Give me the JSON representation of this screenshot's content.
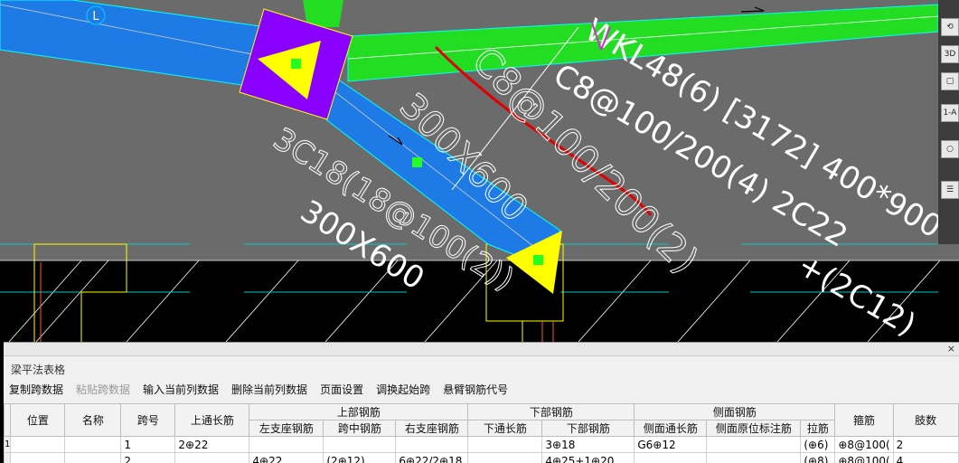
{
  "cad": {
    "axis_label": "L",
    "beam_text_1": "WKL48(6) [3172] 400*900",
    "beam_text_2": "C8@100/200(4) 2C22",
    "beam_text_3": "+(2C12)",
    "beam_text_4": "3C18(18@100(2))",
    "beam_text_5": "300X600",
    "handwritten_1": "C8@100/200(2)",
    "handwritten_2": "300X600",
    "handwritten_3": "3C18",
    "colors": {
      "background": "#6b6b6b",
      "blue_beam": "#1e7be6",
      "green_beam": "#22dd22",
      "column": "#8a00ff",
      "marker": "#ffff00",
      "red_annotation": "#e00000",
      "magenta_text": "#cc33cc"
    }
  },
  "right_tools": [
    "3D",
    "1-A"
  ],
  "panel": {
    "title": "梁平法表格",
    "close_icon": "×",
    "toolbar": [
      {
        "label": "复制跨数据",
        "enabled": true
      },
      {
        "label": "粘贴跨数据",
        "enabled": false
      },
      {
        "label": "输入当前列数据",
        "enabled": true
      },
      {
        "label": "删除当前列数据",
        "enabled": true
      },
      {
        "label": "页面设置",
        "enabled": true
      },
      {
        "label": "调换起始跨",
        "enabled": true
      },
      {
        "label": "悬臂钢筋代号",
        "enabled": true
      }
    ],
    "group_headers": {
      "top": "上部钢筋",
      "bottom": "下部钢筋",
      "side": "侧面钢筋"
    },
    "columns": {
      "position": "位置",
      "name": "名称",
      "span": "跨号",
      "top_through": "上通长筋",
      "left_support": "左支座钢筋",
      "mid_span": "跨中钢筋",
      "right_support": "右支座钢筋",
      "bottom_through": "下通长筋",
      "bottom_bar": "下部钢筋",
      "side_through": "侧面通长筋",
      "side_local": "侧面原位标注筋",
      "tie": "拉筋",
      "stirrup": "箍筋",
      "legs": "肢数"
    },
    "rows": [
      {
        "num": "1",
        "position": "",
        "name": "",
        "span": "1",
        "top_through": "2⊕22",
        "left_support": "",
        "mid_span": "",
        "right_support": "",
        "bottom_through": "",
        "bottom_bar": "3⊕18",
        "side_through": "G6⊕12",
        "side_local": "",
        "tie": "(⊕6)",
        "stirrup": "⊕8@100(",
        "legs": "2"
      },
      {
        "num": "",
        "position": "",
        "name": "",
        "span": "2",
        "top_through": "",
        "left_support": "4⊕22",
        "mid_span": "(2⊕12)",
        "right_support": "6⊕22/2⊕18",
        "bottom_through": "",
        "bottom_bar": "4⊕25+1⊕20",
        "side_through": "",
        "side_local": "",
        "tie": "(⊕8)",
        "stirrup": "⊕8@100(",
        "legs": "4"
      }
    ]
  }
}
